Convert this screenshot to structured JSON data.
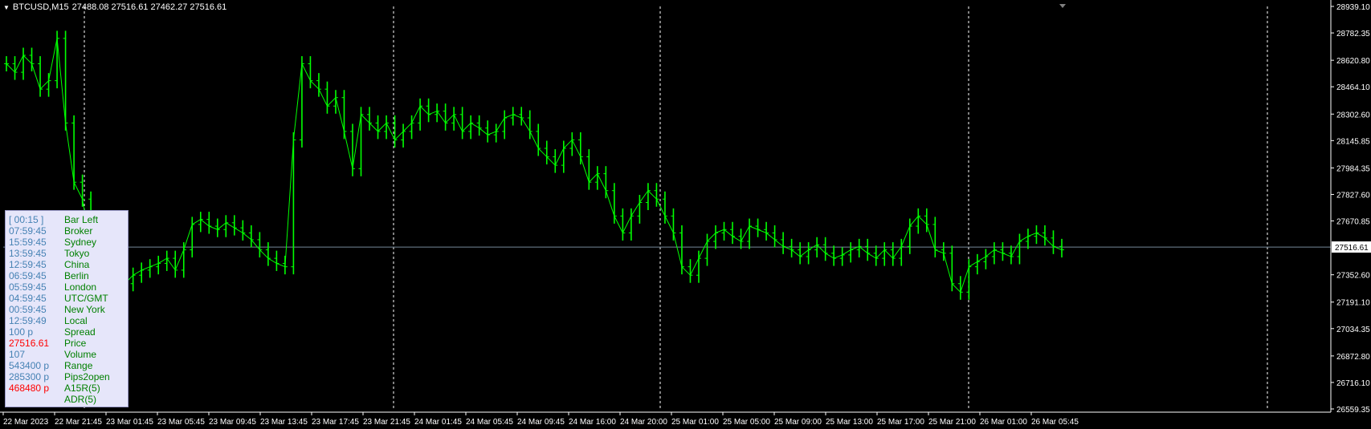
{
  "header": {
    "symbol": "BTCUSD,M15",
    "ohlc": "27488.08 27516.61 27462.27 27516.61"
  },
  "colors": {
    "background": "#000000",
    "candle": "#00ff00",
    "grid": "#ffffff",
    "axis_text": "#ffffff",
    "bid_line": "#778899",
    "panel_bg": "#e6e6fa",
    "panel_value": "#4682b4",
    "panel_label": "#008000",
    "panel_alert": "#ff0000"
  },
  "current_price_label": "27516.61",
  "info_panel": [
    {
      "value": "[ 00:15 ]",
      "label": "Bar Left",
      "value_color": "#4682b4"
    },
    {
      "value": "07:59:45",
      "label": "Broker",
      "value_color": "#4682b4"
    },
    {
      "value": "15:59:45",
      "label": "Sydney",
      "value_color": "#4682b4"
    },
    {
      "value": "13:59:45",
      "label": "Tokyo",
      "value_color": "#4682b4"
    },
    {
      "value": "12:59:45",
      "label": "China",
      "value_color": "#4682b4"
    },
    {
      "value": "06:59:45",
      "label": "Berlin",
      "value_color": "#4682b4"
    },
    {
      "value": "05:59:45",
      "label": "London",
      "value_color": "#4682b4"
    },
    {
      "value": "04:59:45",
      "label": "UTC/GMT",
      "value_color": "#4682b4"
    },
    {
      "value": "00:59:45",
      "label": "New York",
      "value_color": "#4682b4"
    },
    {
      "value": "12:59:49",
      "label": "Local",
      "value_color": "#4682b4"
    },
    {
      "value": "100 p",
      "label": "Spread",
      "value_color": "#4682b4"
    },
    {
      "value": "27516.61",
      "label": "Price",
      "value_color": "#ff0000"
    },
    {
      "value": "107",
      "label": "Volume",
      "value_color": "#4682b4"
    },
    {
      "value": "543400 p",
      "label": "Range",
      "value_color": "#4682b4"
    },
    {
      "value": "285300 p",
      "label": "Pips2open",
      "value_color": "#4682b4"
    },
    {
      "value": "468480 p",
      "label": "A15R(5)",
      "value_color": "#ff0000"
    },
    {
      "value": "",
      "label": "ADR(5)",
      "value_color": "#4682b4"
    }
  ],
  "chart_data": {
    "type": "line",
    "title": "BTCUSD,M15",
    "candle_style": "green bars on black",
    "y_ticks": [
      "28939.10",
      "28782.35",
      "28620.80",
      "28464.10",
      "28302.60",
      "28145.85",
      "27984.35",
      "27827.60",
      "27670.85",
      "27516.61",
      "27352.60",
      "27191.10",
      "27034.35",
      "26872.80",
      "26716.10",
      "26559.35"
    ],
    "ylim": [
      26559.35,
      28939.1
    ],
    "x_ticks": [
      "22 Mar 2023",
      "22 Mar 21:45",
      "23 Mar 01:45",
      "23 Mar 05:45",
      "23 Mar 09:45",
      "23 Mar 13:45",
      "23 Mar 17:45",
      "23 Mar 21:45",
      "24 Mar 01:45",
      "24 Mar 05:45",
      "24 Mar 09:45",
      "24 Mar 16:00",
      "24 Mar 20:00",
      "25 Mar 01:00",
      "25 Mar 05:00",
      "25 Mar 09:00",
      "25 Mar 13:00",
      "25 Mar 17:00",
      "25 Mar 21:00",
      "26 Mar 01:00",
      "26 Mar 05:45"
    ],
    "day_separators": [
      "23 Mar",
      "24 Mar",
      "25 Mar",
      "26 Mar",
      "27 Mar"
    ],
    "bid_line": 27516.61,
    "series": [
      {
        "values": [
          28600,
          28550,
          28650,
          28600,
          28450,
          28500,
          28750,
          28250,
          27900,
          27800,
          27500,
          27300,
          27200,
          27250,
          27300,
          27350,
          27380,
          27400,
          27420,
          27450,
          27380,
          27500,
          27650,
          27680,
          27640,
          27620,
          27660,
          27630,
          27600,
          27560,
          27500,
          27450,
          27420,
          27400,
          28150,
          28600,
          28500,
          28450,
          28350,
          28400,
          28200,
          27980,
          28300,
          28250,
          28200,
          28250,
          28150,
          28200,
          28250,
          28350,
          28300,
          28320,
          28250,
          28300,
          28200,
          28250,
          28220,
          28180,
          28200,
          28280,
          28300,
          28280,
          28200,
          28100,
          28050,
          28000,
          28100,
          28150,
          28050,
          27900,
          27950,
          27850,
          27700,
          27600,
          27700,
          27780,
          27850,
          27800,
          27700,
          27600,
          27400,
          27350,
          27450,
          27550,
          27600,
          27620,
          27580,
          27550,
          27640,
          27620,
          27600,
          27560,
          27520,
          27500,
          27460,
          27500,
          27530,
          27480,
          27450,
          27470,
          27500,
          27520,
          27480,
          27450,
          27500,
          27450,
          27520,
          27640,
          27700,
          27650,
          27500,
          27480,
          27300,
          27250,
          27400,
          27430,
          27460,
          27500,
          27480,
          27460,
          27550,
          27580,
          27600,
          27570,
          27520,
          27500
        ]
      }
    ]
  }
}
